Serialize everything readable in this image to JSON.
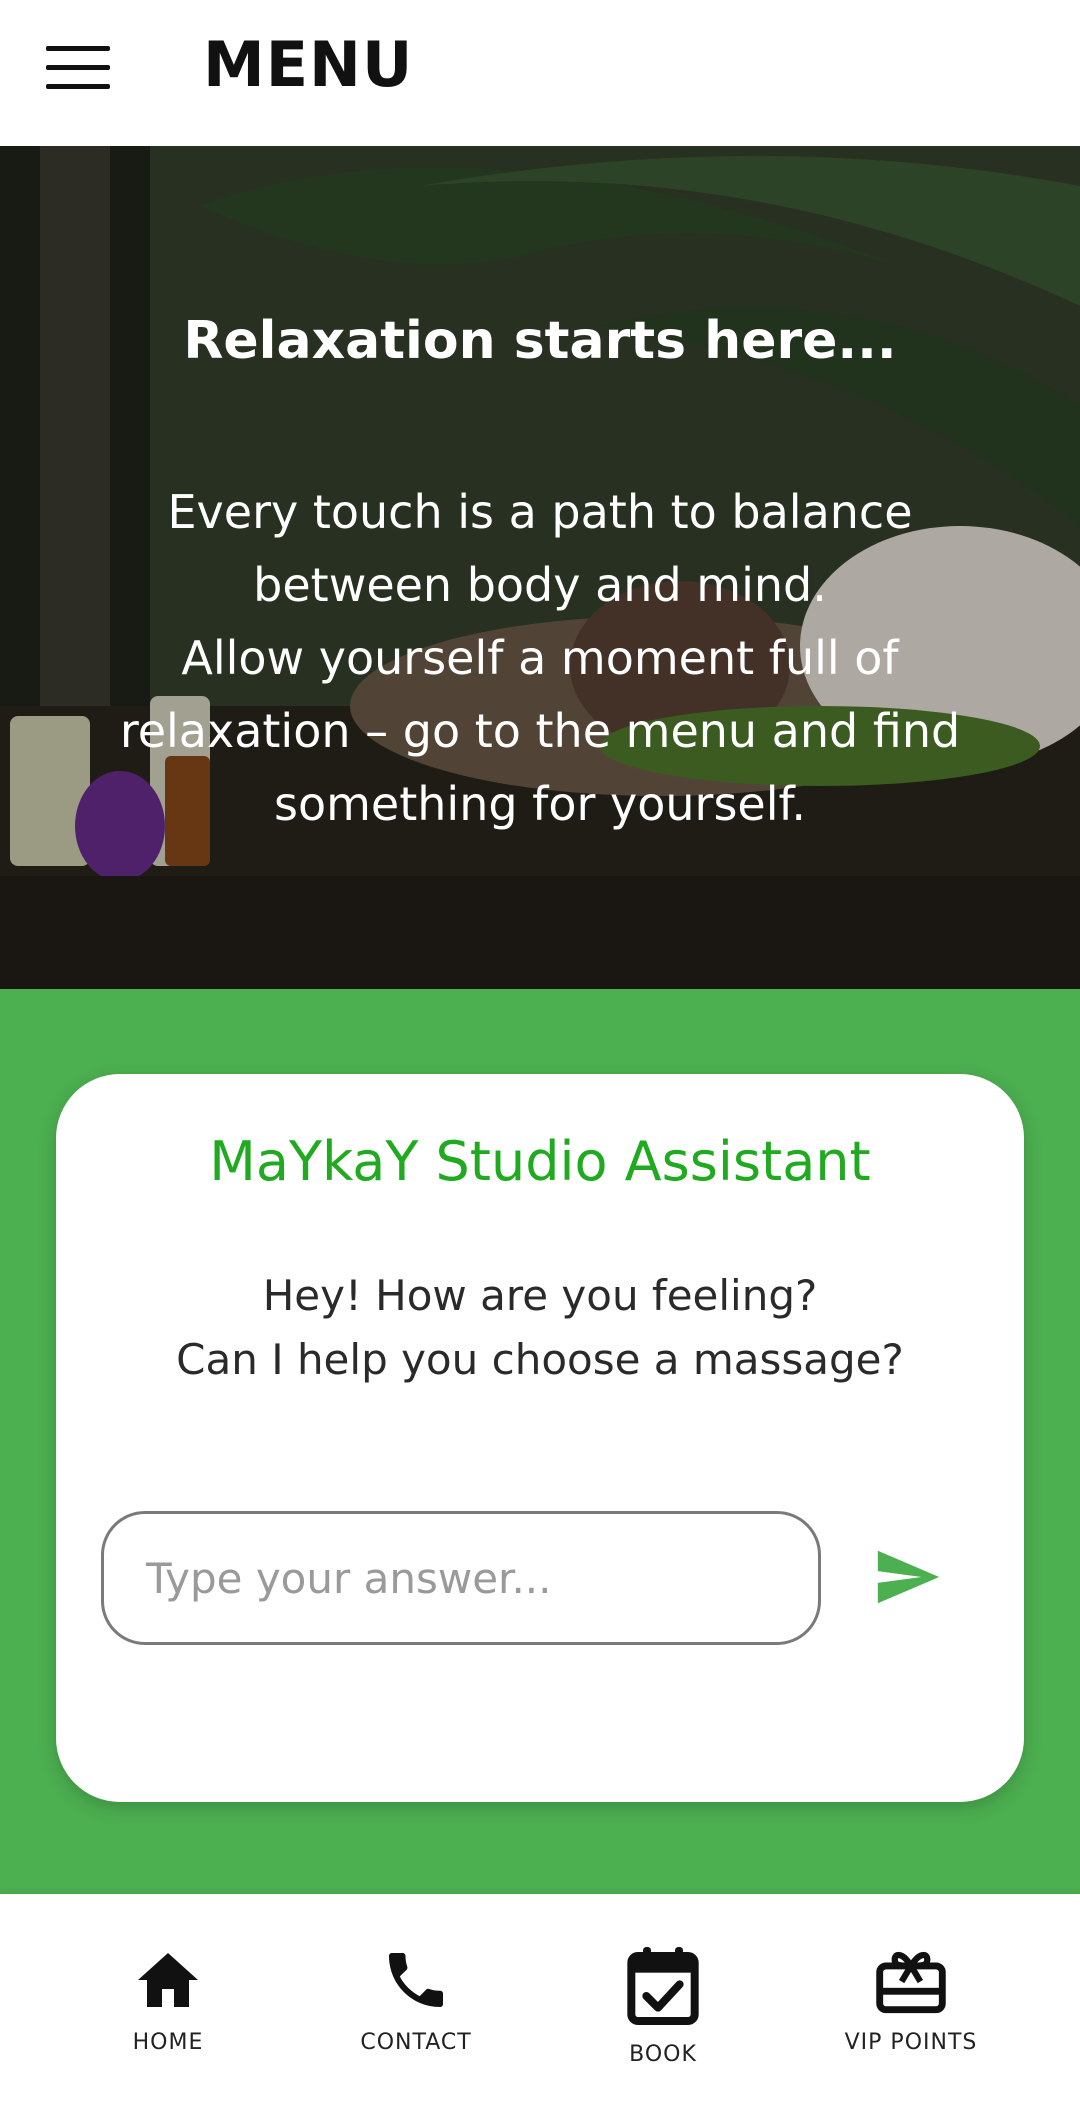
{
  "header": {
    "menu_icon": "hamburger-icon",
    "title": "MENU"
  },
  "hero": {
    "title": "Relaxation starts here...",
    "lines": [
      "Every touch is a path to balance",
      "between body and mind.",
      "Allow yourself a moment full of",
      "relaxation – go to the menu and find",
      "something for yourself."
    ]
  },
  "assistant": {
    "title": "MaYkaY Studio Assistant",
    "message_line1": "Hey! How are you feeling?",
    "message_line2": "Can I help you choose a massage?",
    "input_placeholder": "Type your answer...",
    "input_value": "",
    "send_icon": "send-icon"
  },
  "bottom_nav": {
    "items": [
      {
        "label": "HOME",
        "icon": "home-icon"
      },
      {
        "label": "CONTACT",
        "icon": "phone-icon"
      },
      {
        "label": "BOOK",
        "icon": "calendar-check-icon"
      },
      {
        "label": "VIP POINTS",
        "icon": "gift-card-icon"
      }
    ]
  },
  "colors": {
    "accent_green": "#4caf50",
    "title_green": "#1faa1f",
    "text_dark": "#111111"
  }
}
